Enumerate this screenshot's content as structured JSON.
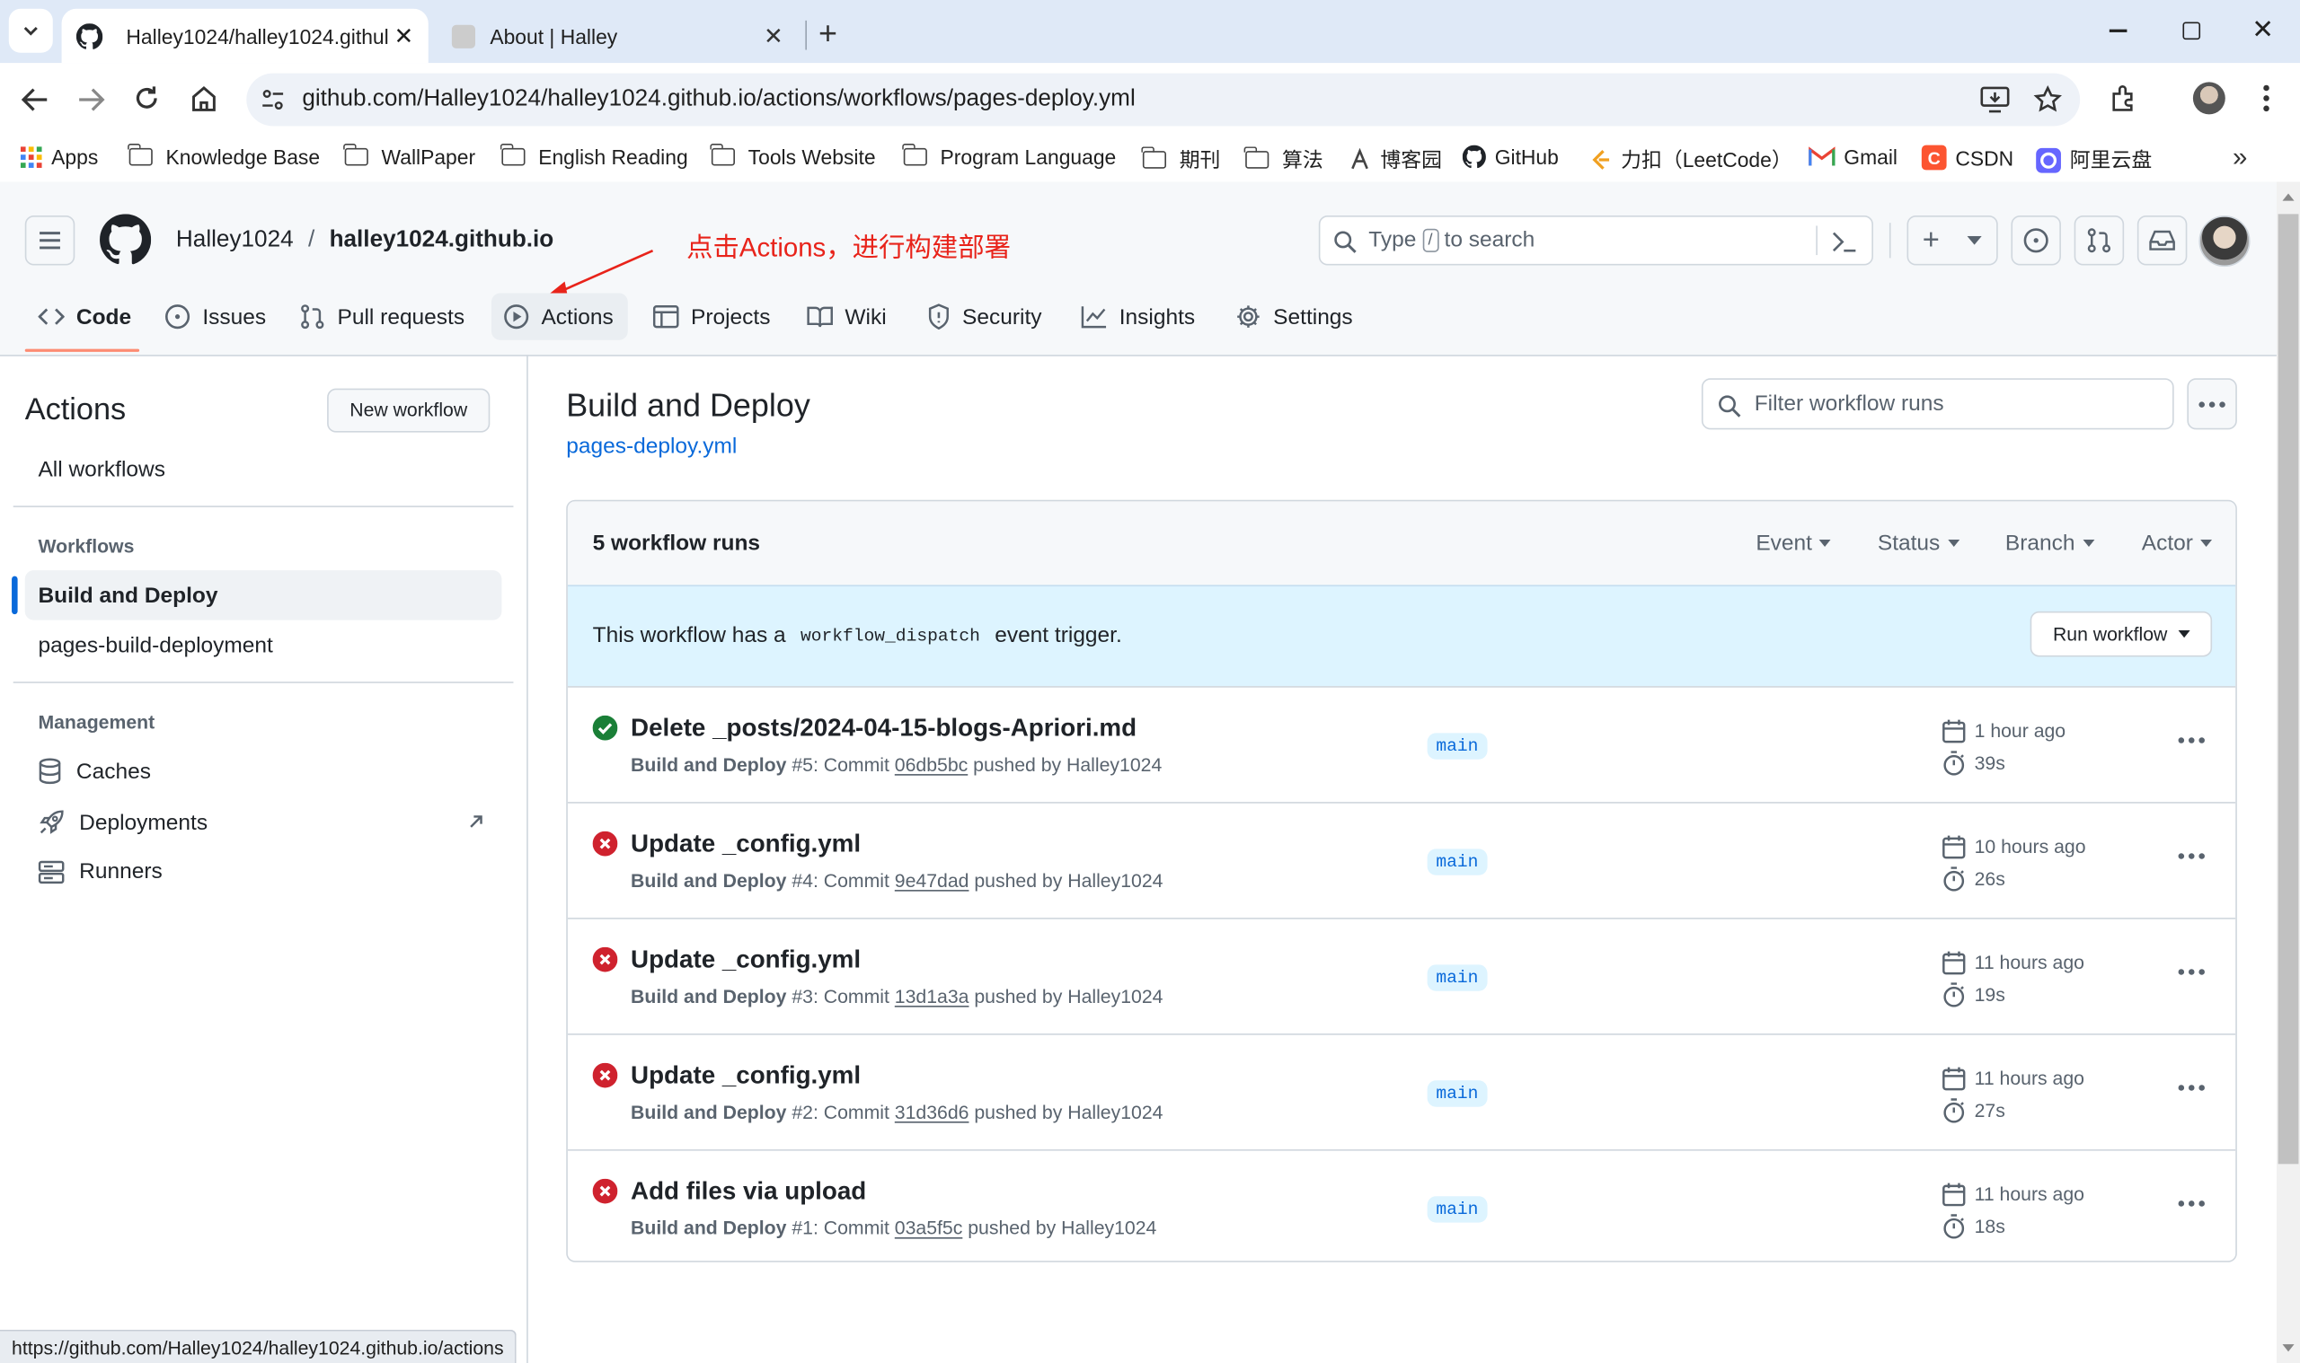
{
  "browser": {
    "tabs": [
      {
        "title": "Halley1024/halley1024.githul",
        "active": true
      },
      {
        "title": "About | Halley",
        "active": false
      }
    ],
    "url": "github.com/Halley1024/halley1024.github.io/actions/workflows/pages-deploy.yml",
    "bookmarks": [
      {
        "label": "Apps",
        "icon": "apps-grid-icon"
      },
      {
        "label": "Knowledge Base",
        "icon": "folder-icon"
      },
      {
        "label": "WallPaper",
        "icon": "folder-icon"
      },
      {
        "label": "English Reading",
        "icon": "folder-icon"
      },
      {
        "label": "Tools Website",
        "icon": "folder-icon"
      },
      {
        "label": "Program Language",
        "icon": "folder-icon"
      },
      {
        "label": "期刊",
        "icon": "folder-icon"
      },
      {
        "label": "算法",
        "icon": "folder-icon"
      },
      {
        "label": "博客园",
        "icon": "cnblogs-icon"
      },
      {
        "label": "GitHub",
        "icon": "github-icon"
      },
      {
        "label": "力扣（LeetCode）",
        "icon": "leetcode-icon"
      },
      {
        "label": "Gmail",
        "icon": "gmail-icon"
      },
      {
        "label": "CSDN",
        "icon": "csdn-icon"
      },
      {
        "label": "阿里云盘",
        "icon": "aliyun-drive-icon"
      }
    ],
    "status_url": "https://github.com/Halley1024/halley1024.github.io/actions"
  },
  "repo": {
    "owner": "Halley1024",
    "separator": "/",
    "name": "halley1024.github.io"
  },
  "annotation": {
    "text": "点击Actions，进行构建部署",
    "color": "#e8231a"
  },
  "search": {
    "pre": "Type",
    "key": "/",
    "post": "to search"
  },
  "repo_nav": [
    {
      "label": "Code",
      "icon": "code-icon",
      "selected": true
    },
    {
      "label": "Issues",
      "icon": "issue-icon"
    },
    {
      "label": "Pull requests",
      "icon": "pull-request-icon"
    },
    {
      "label": "Actions",
      "icon": "play-icon"
    },
    {
      "label": "Projects",
      "icon": "table-icon"
    },
    {
      "label": "Wiki",
      "icon": "book-icon"
    },
    {
      "label": "Security",
      "icon": "shield-icon"
    },
    {
      "label": "Insights",
      "icon": "graph-icon"
    },
    {
      "label": "Settings",
      "icon": "gear-icon"
    }
  ],
  "sidebar": {
    "title": "Actions",
    "new_workflow": "New workflow",
    "all_workflows": "All workflows",
    "workflows_heading": "Workflows",
    "workflows": [
      {
        "label": "Build and Deploy",
        "selected": true
      },
      {
        "label": "pages-build-deployment",
        "selected": false
      }
    ],
    "management_heading": "Management",
    "management": [
      {
        "label": "Caches",
        "icon": "database-icon"
      },
      {
        "label": "Deployments",
        "icon": "rocket-icon",
        "external": true
      },
      {
        "label": "Runners",
        "icon": "server-icon"
      }
    ]
  },
  "main": {
    "title": "Build and Deploy",
    "file_link": "pages-deploy.yml",
    "filter_placeholder": "Filter workflow runs",
    "runs_count": "5 workflow runs",
    "filters": [
      "Event",
      "Status",
      "Branch",
      "Actor"
    ],
    "dispatch": {
      "pre": "This workflow has a",
      "code": "workflow_dispatch",
      "post": "event trigger.",
      "button": "Run workflow"
    },
    "runs": [
      {
        "title": "Delete _posts/2024-04-15-blogs-Apriori.md",
        "workflow": "Build and Deploy",
        "number": "#5",
        "sha": "06db5bc",
        "user": "Halley1024",
        "branch": "main",
        "time": "1 hour ago",
        "duration": "39s",
        "status": "success"
      },
      {
        "title": "Update _config.yml",
        "workflow": "Build and Deploy",
        "number": "#4",
        "sha": "9e47dad",
        "user": "Halley1024",
        "branch": "main",
        "time": "10 hours ago",
        "duration": "26s",
        "status": "failure"
      },
      {
        "title": "Update _config.yml",
        "workflow": "Build and Deploy",
        "number": "#3",
        "sha": "13d1a3a",
        "user": "Halley1024",
        "branch": "main",
        "time": "11 hours ago",
        "duration": "19s",
        "status": "failure"
      },
      {
        "title": "Update _config.yml",
        "workflow": "Build and Deploy",
        "number": "#2",
        "sha": "31d36d6",
        "user": "Halley1024",
        "branch": "main",
        "time": "11 hours ago",
        "duration": "27s",
        "status": "failure"
      },
      {
        "title": "Add files via upload",
        "workflow": "Build and Deploy",
        "number": "#1",
        "sha": "03a5f5c",
        "user": "Halley1024",
        "branch": "main",
        "time": "11 hours ago",
        "duration": "18s",
        "status": "failure"
      }
    ],
    "commit_word": "Commit",
    "pushed_by": "pushed by"
  },
  "colors": {
    "success": "#1a7f37",
    "failure": "#cf222e",
    "link": "#0969da",
    "selected_indicator": "#0969da",
    "code_underline": "#fd8c73"
  }
}
